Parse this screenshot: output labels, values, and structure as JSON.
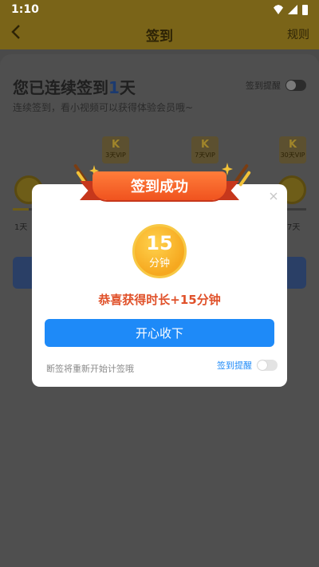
{
  "status_bar": {
    "time": "1:10"
  },
  "header": {
    "title": "签到",
    "rules_label": "规则",
    "back_icon": "chevron-left-icon"
  },
  "page": {
    "streak_prefix": "您已连续签到",
    "streak_days": "1",
    "streak_suffix": "天",
    "subtitle": "连续签到，看小视频可以获得体验会员哦~",
    "reminder_label": "签到提醒",
    "vip_badges": [
      "K",
      "K",
      "K"
    ],
    "badge_tags": [
      "3天VIP",
      "7天VIP",
      "30天VIP"
    ],
    "day_labels": [
      "1天",
      "7天"
    ]
  },
  "modal": {
    "ribbon_text": "签到成功",
    "medal_value": "15",
    "medal_unit": "分钟",
    "congrats_text": "恭喜获得时长+15分钟",
    "confirm_label": "开心收下",
    "footer_note": "断签将重新开始计签哦",
    "reminder_label": "签到提醒",
    "reminder_enabled": false,
    "accent_color": "#1e8af8",
    "ribbon_color": "#f0531f",
    "medal_color": "#f6a81f"
  }
}
